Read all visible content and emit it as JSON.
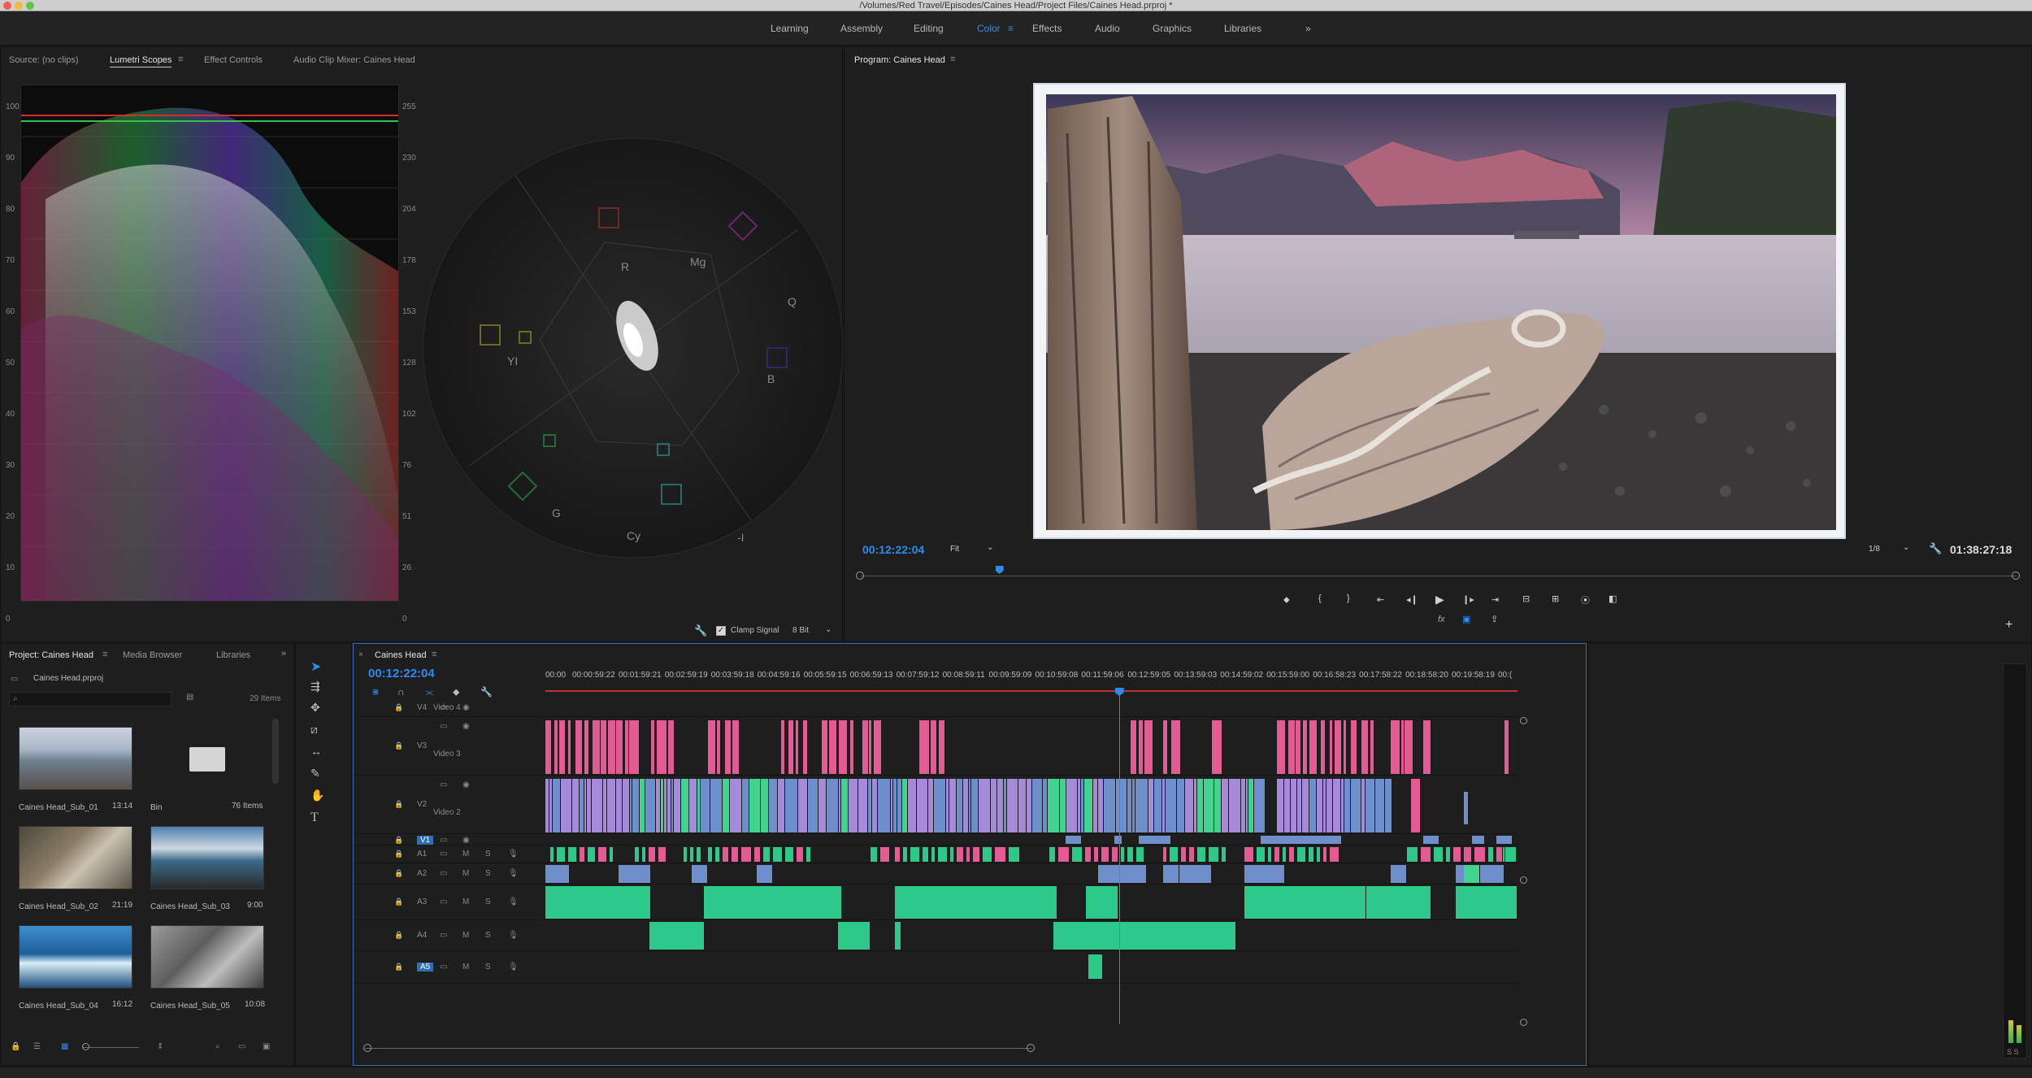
{
  "window": {
    "title": "/Volumes/Red Travel/Episodes/Caines Head/Project Files/Caines Head.prproj *"
  },
  "workspaces": [
    {
      "label": "Learning",
      "active": false
    },
    {
      "label": "Assembly",
      "active": false
    },
    {
      "label": "Editing",
      "active": false
    },
    {
      "label": "Color",
      "active": true
    },
    {
      "label": "Effects",
      "active": false
    },
    {
      "label": "Audio",
      "active": false
    },
    {
      "label": "Graphics",
      "active": false
    },
    {
      "label": "Libraries",
      "active": false
    }
  ],
  "workspaces_more": "»",
  "source_panel": {
    "tabs": [
      "Source: (no clips)",
      "Lumetri Scopes",
      "Effect Controls",
      "Audio Clip Mixer: Caines Head"
    ],
    "active_tab": "Lumetri Scopes",
    "waveform_left_ticks": [
      "100",
      "90",
      "80",
      "70",
      "60",
      "50",
      "40",
      "30",
      "20",
      "10",
      "0"
    ],
    "waveform_right_ticks": [
      "255",
      "230",
      "204",
      "178",
      "153",
      "128",
      "102",
      "76",
      "51",
      "26",
      "0"
    ],
    "vectorscope_labels": [
      "R",
      "Mg",
      "Q",
      "B",
      "-I",
      "Cy",
      "G",
      "YI"
    ],
    "clamp_signal_label": "Clamp Signal",
    "bit_depth": "8 Bit"
  },
  "program_monitor": {
    "title": "Program: Caines Head",
    "timecode": "00:12:22:04",
    "fit": "Fit",
    "resolution": "1/8",
    "duration": "01:38:27:18",
    "playhead_fraction": 0.12
  },
  "project_panel": {
    "tabs": [
      "Project: Caines Head",
      "Media Browser",
      "Libraries"
    ],
    "more": "»",
    "file": "Caines Head.prproj",
    "item_count": "29 Items",
    "items": [
      {
        "name": "Caines Head_Sub_01",
        "duration": "13:14",
        "kind": "clip"
      },
      {
        "name": "Bin",
        "duration": "76 Items",
        "kind": "bin"
      },
      {
        "name": "Caines Head_Sub_02",
        "duration": "21:19",
        "kind": "clip"
      },
      {
        "name": "Caines Head_Sub_03",
        "duration": "9:00",
        "kind": "clip"
      },
      {
        "name": "Caines Head_Sub_04",
        "duration": "16:12",
        "kind": "clip"
      },
      {
        "name": "Caines Head_Sub_05",
        "duration": "10:08",
        "kind": "clip"
      }
    ]
  },
  "timeline": {
    "sequence_name": "Caines Head",
    "timecode": "00:12:22:04",
    "ruler": [
      "00:00",
      "00:00:59:22",
      "00:01:59:21",
      "00:02:59:19",
      "00:03:59:18",
      "00:04:59:16",
      "00:05:59:15",
      "00:06:59:13",
      "00:07:59:12",
      "00:08:59:11",
      "00:09:59:09",
      "00:10:59:08",
      "00:11:59:06",
      "00:12:59:05",
      "00:13:59:03",
      "00:14:59:02",
      "00:15:59:00",
      "00:16:58:23",
      "00:17:58:22",
      "00:18:58:20",
      "00:19:58:19",
      "00:("
    ],
    "playhead_fraction": 0.59,
    "video_tracks": [
      {
        "id": "V4",
        "name": "Video 4"
      },
      {
        "id": "V3",
        "name": "Video 3"
      },
      {
        "id": "V2",
        "name": "Video 2"
      },
      {
        "id": "V1",
        "name": ""
      }
    ],
    "audio_tracks": [
      {
        "id": "A1"
      },
      {
        "id": "A2"
      },
      {
        "id": "A3"
      },
      {
        "id": "A4"
      },
      {
        "id": "A5"
      }
    ],
    "track_button_labels": {
      "mute": "M",
      "solo": "S"
    }
  },
  "meter": {
    "label": "S S"
  }
}
